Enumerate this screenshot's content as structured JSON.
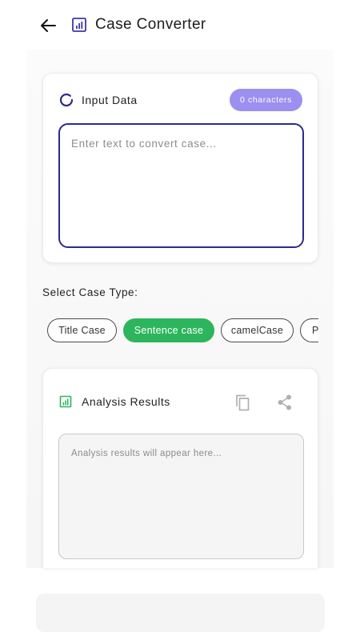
{
  "header": {
    "title": "Case Converter",
    "back_icon": "arrow-left-icon",
    "app_icon": "chart-icon"
  },
  "input_card": {
    "title": "Input Data",
    "icon": "loading-ring-icon",
    "char_badge": "0 characters",
    "placeholder": "Enter text to convert case...",
    "value": ""
  },
  "case_selector": {
    "label": "Select Case Type:",
    "options": [
      "Title Case",
      "Sentence case",
      "camelCase",
      "P"
    ],
    "selected": "Sentence case"
  },
  "results_card": {
    "title": "Analysis Results",
    "icon": "chart-icon",
    "copy_icon": "copy-icon",
    "share_icon": "share-icon",
    "placeholder": "Analysis results will appear here..."
  },
  "colors": {
    "accent": "#2d2a8c",
    "badge": "#9b8ff0",
    "selected_chip": "#2db55d",
    "result_icon": "#2db55d"
  }
}
